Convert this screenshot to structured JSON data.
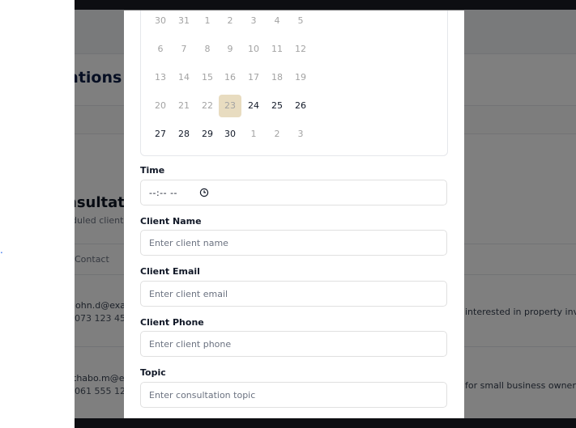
{
  "background": {
    "page_heading_fragment": "ations",
    "filter_fragment": "",
    "status_fragment": "d",
    "section_title_fragment": "nsultati",
    "section_sub_fragment": "duled client",
    "table_header_contact": "Contact",
    "rows": [
      {
        "email": "john.d@exar",
        "phone": "073 123 456",
        "topic": "interested in property invest"
      },
      {
        "email": "thabo.m@ex",
        "phone": "061 555 123",
        "topic": "for small business owner"
      }
    ],
    "stray_mark": "."
  },
  "modal": {
    "calendar": {
      "weeks": [
        [
          "30",
          "31",
          "1",
          "2",
          "3",
          "4",
          "5"
        ],
        [
          "6",
          "7",
          "8",
          "9",
          "10",
          "11",
          "12"
        ],
        [
          "13",
          "14",
          "15",
          "16",
          "17",
          "18",
          "19"
        ],
        [
          "20",
          "21",
          "22",
          "23",
          "24",
          "25",
          "26"
        ],
        [
          "27",
          "28",
          "29",
          "30",
          "1",
          "2",
          "3"
        ]
      ],
      "muted_rule": "all of weeks 1-3, days 20-22 and trailing 1-3 are muted",
      "selected_day": "23"
    },
    "fields": {
      "time": {
        "label": "Time",
        "value": "--:-- --",
        "icon": "clock-icon"
      },
      "client_name": {
        "label": "Client Name",
        "placeholder": "Enter client name"
      },
      "client_email": {
        "label": "Client Email",
        "placeholder": "Enter client email"
      },
      "client_phone": {
        "label": "Client Phone",
        "placeholder": "Enter client phone"
      },
      "topic": {
        "label": "Topic",
        "placeholder": "Enter consultation topic"
      }
    }
  },
  "colors": {
    "overlay": "rgba(0,0,0,0.5)",
    "selected_day_bg": "#e8dcc0",
    "heading": "#0f1f47"
  }
}
